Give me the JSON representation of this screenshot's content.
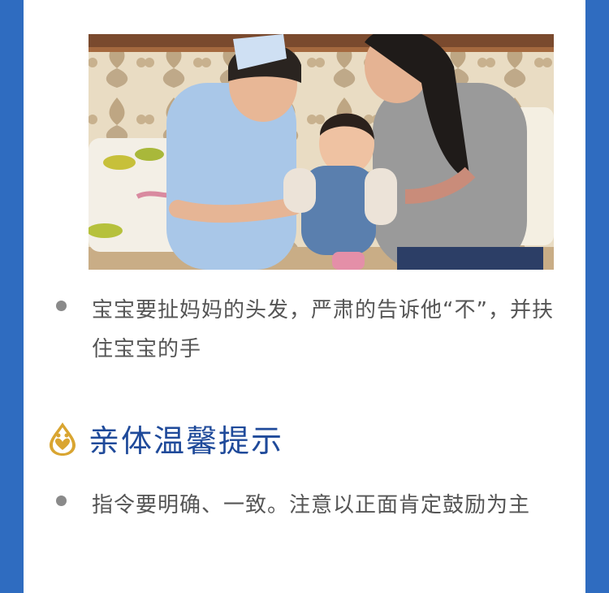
{
  "caption_1": "宝宝要扯妈妈的头发，严肃的告诉他“不”，并扶住宝宝的手",
  "tips_heading": "亲体温馨提示",
  "tip_1": "指令要明确、一致。注意以正面肯定鼓励为主",
  "icons": {
    "tips": "water-drop-heart-icon"
  },
  "colors": {
    "side_band": "#2f6cc0",
    "heading_blue": "#1f4a9a",
    "body_text": "#555555",
    "bullet_gray": "#8a8a8a",
    "icon_gold": "#d9a531"
  }
}
